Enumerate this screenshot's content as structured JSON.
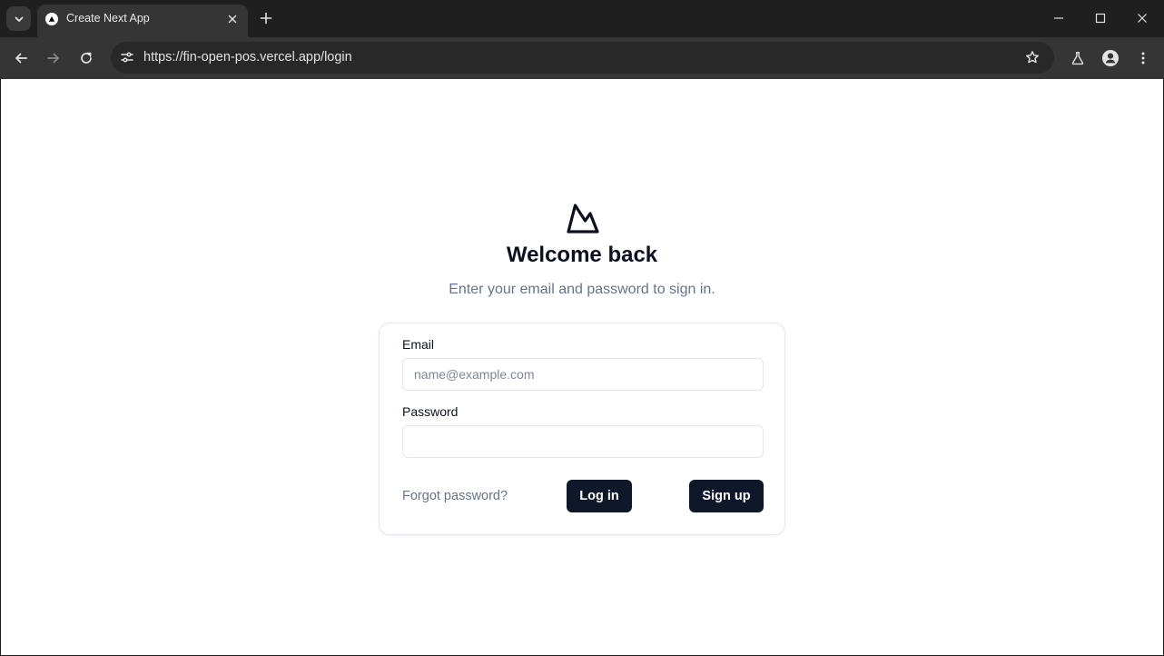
{
  "browser": {
    "tab": {
      "title": "Create Next App",
      "favicon": "vercel-triangle-icon"
    },
    "url": "https://fin-open-pos.vercel.app/login",
    "icons": {
      "tab_search": "chevron-down-icon",
      "new_tab": "plus-icon",
      "back": "arrow-left-icon",
      "forward": "arrow-right-icon",
      "reload": "reload-icon",
      "site_info": "tune-icon",
      "bookmark": "star-outline-icon",
      "labs": "flask-icon",
      "profile": "profile-icon",
      "menu": "kebab-menu-icon",
      "minimize": "minimize-icon",
      "maximize": "maximize-icon",
      "close": "close-icon"
    }
  },
  "login": {
    "logo": "mountain-icon",
    "title": "Welcome back",
    "subtitle": "Enter your email and password to sign in.",
    "email": {
      "label": "Email",
      "placeholder": "name@example.com",
      "value": ""
    },
    "password": {
      "label": "Password",
      "placeholder": "",
      "value": ""
    },
    "forgot_label": "Forgot password?",
    "login_label": "Log in",
    "signup_label": "Sign up"
  },
  "colors": {
    "primary": "#0f172a",
    "heading": "#0b1120",
    "muted": "#64748b",
    "border": "#e2e8f0",
    "chrome_dark": "#1f1f1f",
    "chrome_toolbar": "#353535"
  }
}
